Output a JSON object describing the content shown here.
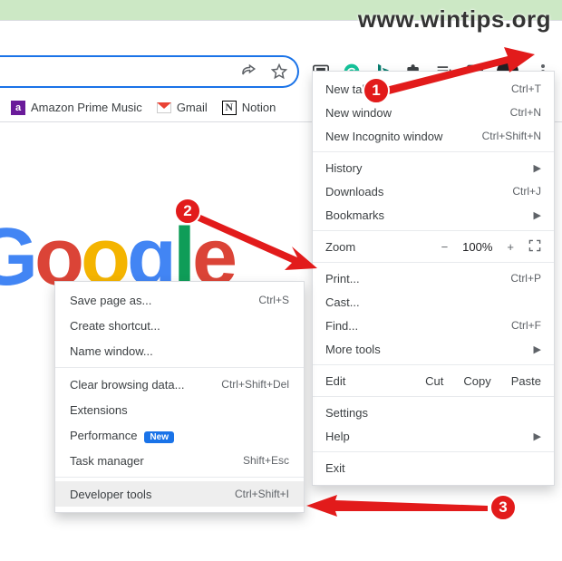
{
  "watermark": "www.wintips.org",
  "bookmarks": {
    "apm": "Amazon Prime Music",
    "gmail": "Gmail",
    "notion": "Notion"
  },
  "google_logo": [
    "G",
    "o",
    "o",
    "g",
    "l",
    "e"
  ],
  "main_menu": {
    "new_tab": {
      "label": "New tab",
      "shortcut": "Ctrl+T"
    },
    "new_window": {
      "label": "New window",
      "shortcut": "Ctrl+N"
    },
    "incognito": {
      "label": "New Incognito window",
      "shortcut": "Ctrl+Shift+N"
    },
    "history": {
      "label": "History"
    },
    "downloads": {
      "label": "Downloads",
      "shortcut": "Ctrl+J"
    },
    "bookmarks": {
      "label": "Bookmarks"
    },
    "zoom": {
      "label": "Zoom",
      "minus": "−",
      "pct": "100%",
      "plus": "+"
    },
    "print": {
      "label": "Print...",
      "shortcut": "Ctrl+P"
    },
    "cast": {
      "label": "Cast..."
    },
    "find": {
      "label": "Find...",
      "shortcut": "Ctrl+F"
    },
    "more_tools": {
      "label": "More tools"
    },
    "edit": {
      "label": "Edit",
      "cut": "Cut",
      "copy": "Copy",
      "paste": "Paste"
    },
    "settings": {
      "label": "Settings"
    },
    "help": {
      "label": "Help"
    },
    "exit": {
      "label": "Exit"
    }
  },
  "submenu": {
    "save_page": {
      "label": "Save page as...",
      "shortcut": "Ctrl+S"
    },
    "create_shortcut": {
      "label": "Create shortcut..."
    },
    "name_window": {
      "label": "Name window..."
    },
    "clear_data": {
      "label": "Clear browsing data...",
      "shortcut": "Ctrl+Shift+Del"
    },
    "extensions": {
      "label": "Extensions"
    },
    "performance": {
      "label": "Performance",
      "badge": "New"
    },
    "task_manager": {
      "label": "Task manager",
      "shortcut": "Shift+Esc"
    },
    "dev_tools": {
      "label": "Developer tools",
      "shortcut": "Ctrl+Shift+I"
    }
  },
  "steps": {
    "s1": "1",
    "s2": "2",
    "s3": "3"
  }
}
